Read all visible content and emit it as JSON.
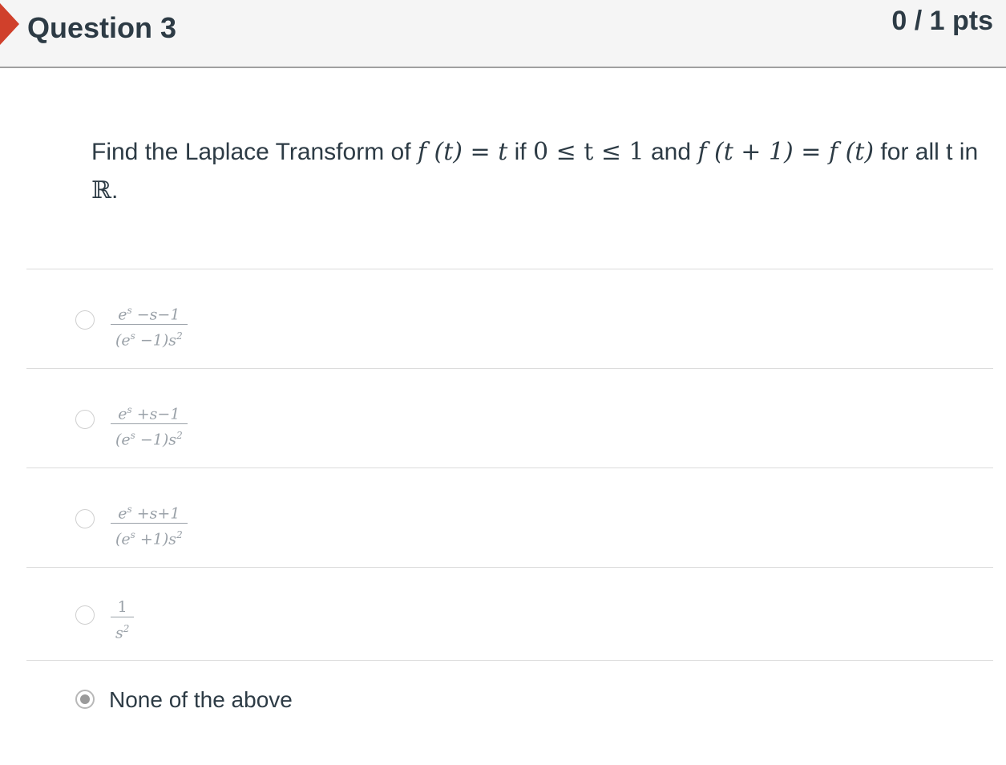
{
  "question": {
    "title": "Question 3",
    "points": "0 / 1 pts",
    "text_part1": "Find the Laplace Transform of",
    "math1": "f (t) = t",
    "text_part2": "if",
    "math2": "0 ≤ t ≤ 1",
    "text_part3": "and",
    "math3": "f (t + 1) = f (t)",
    "text_part4": "for all t in",
    "math4": "ℝ",
    "text_part5": "."
  },
  "answers": [
    {
      "numerator": "e",
      "num_exp": "s",
      "num_rest": " −s−1",
      "denominator": "(e",
      "den_exp": "s",
      "den_rest": " −1)s",
      "den_pow": "2",
      "selected": false
    },
    {
      "numerator": "e",
      "num_exp": "s",
      "num_rest": " +s−1",
      "denominator": "(e",
      "den_exp": "s",
      "den_rest": " −1)s",
      "den_pow": "2",
      "selected": false
    },
    {
      "numerator": "e",
      "num_exp": "s",
      "num_rest": " +s+1",
      "denominator": "(e",
      "den_exp": "s",
      "den_rest": " +1)s",
      "den_pow": "2",
      "selected": false
    },
    {
      "numerator": "1",
      "denominator": "s",
      "den_pow": "2",
      "selected": false
    },
    {
      "label": "None of the above",
      "selected": true
    }
  ]
}
